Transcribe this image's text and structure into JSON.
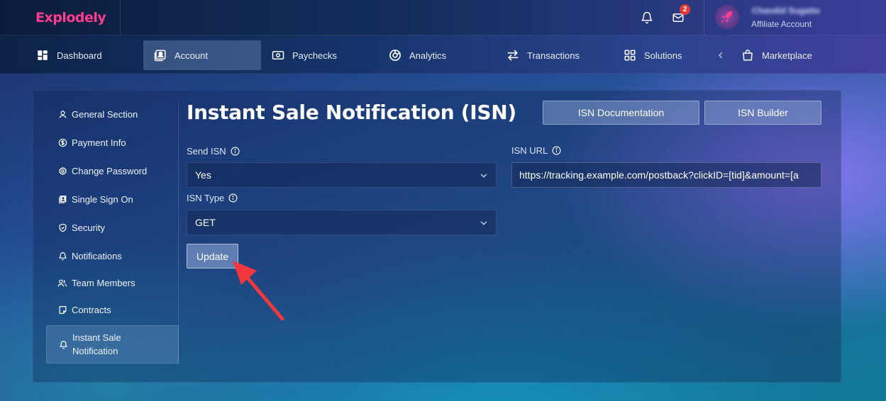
{
  "brand": {
    "logo_text": "Explodely",
    "accent": "#ff3b8d"
  },
  "header": {
    "notifications_icon": "bell-icon",
    "mail_icon": "mail-icon",
    "mail_badge": "2",
    "user_name": "Chandid Sugatto",
    "user_role": "Affiliate Account"
  },
  "nav": {
    "items": [
      {
        "label": "Dashboard",
        "icon": "dashboard-icon"
      },
      {
        "label": "Account",
        "icon": "account-icon",
        "active": true
      },
      {
        "label": "Paychecks",
        "icon": "paycheck-icon"
      },
      {
        "label": "Analytics",
        "icon": "analytics-icon"
      },
      {
        "label": "Transactions",
        "icon": "transactions-icon"
      },
      {
        "label": "Solutions",
        "icon": "solutions-icon"
      },
      {
        "label": "Marketplace",
        "icon": "shopping-bag-icon"
      }
    ]
  },
  "sidebar": {
    "items": [
      {
        "label": "General Section",
        "icon": "user-icon"
      },
      {
        "label": "Payment Info",
        "icon": "dollar-circle-icon"
      },
      {
        "label": "Change Password",
        "icon": "gear-icon"
      },
      {
        "label": "Single Sign On",
        "icon": "id-card-icon"
      },
      {
        "label": "Security",
        "icon": "shield-icon"
      },
      {
        "label": "Notifications",
        "icon": "bell-icon"
      },
      {
        "label": "Team Members",
        "icon": "team-icon"
      },
      {
        "label": "Contracts",
        "icon": "document-icon"
      },
      {
        "label_line1": "Instant Sale",
        "label_line2": "Notification",
        "icon": "bell-icon",
        "active": true
      }
    ]
  },
  "main": {
    "title": "Instant Sale Notification (ISN)",
    "doc_button": "ISN Documentation",
    "builder_button": "ISN Builder",
    "send_isn": {
      "label": "Send ISN",
      "value": "Yes"
    },
    "isn_type": {
      "label": "ISN Type",
      "value": "GET"
    },
    "isn_url": {
      "label": "ISN URL",
      "value": "https://tracking.example.com/postback?clickID=[tid]&amount=[a"
    },
    "update_button": "Update"
  }
}
